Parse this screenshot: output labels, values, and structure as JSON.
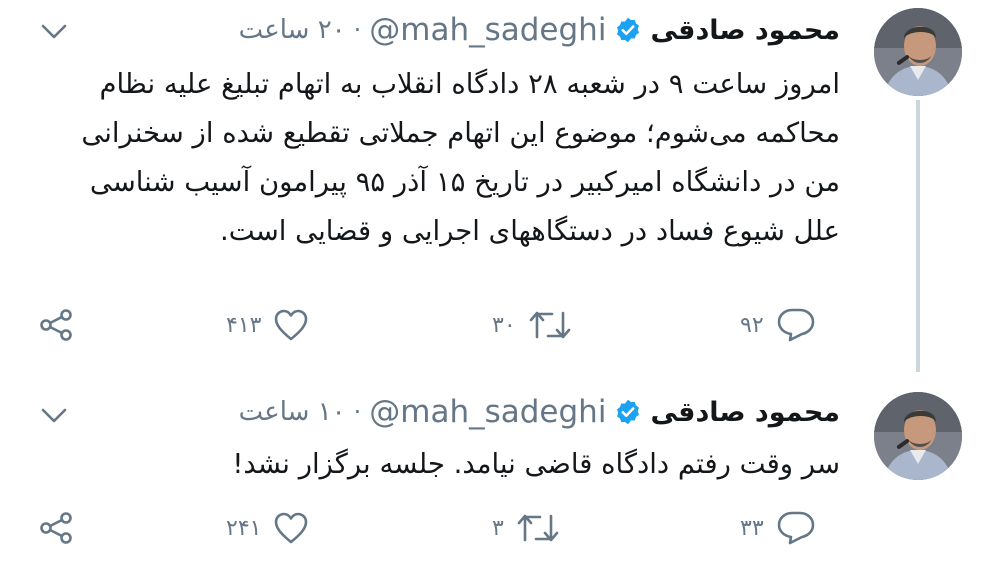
{
  "tweets": [
    {
      "author_name": "محمود صادقی",
      "handle": "@mah_sadeghi",
      "separator": "·",
      "time": "۲۰ ساعت",
      "text": "امروز ساعت ۹ در شعبه ۲۸ دادگاه انقلاب به اتهام تبلیغ علیه نظام محاکمه می‌شوم؛ موضوع این اتهام جملاتی تقطیع شده از سخنرانی من در دانشگاه امیرکبیر در تاریخ ۱۵ آذر ۹۵ پیرامون آسیب شناسی علل شیوع فساد در دستگاههای اجرایی و قضایی است.",
      "reply_count": "۹۲",
      "retweet_count": "۳۰",
      "like_count": "۴۱۳"
    },
    {
      "author_name": "محمود صادقی",
      "handle": "@mah_sadeghi",
      "separator": "·",
      "time": "۱۰ ساعت",
      "text": "سر وقت رفتم دادگاه قاضی نیامد. جلسه برگزار نشد!",
      "reply_count": "۳۳",
      "retweet_count": "۳",
      "like_count": "۲۴۱"
    }
  ],
  "colors": {
    "verified_badge": "#1da1f2",
    "muted_text": "#657786",
    "primary_text": "#14171a",
    "thread_line": "#ccd6dd"
  },
  "icons": [
    "verified-badge-icon",
    "chevron-down-icon",
    "reply-icon",
    "retweet-icon",
    "like-icon",
    "share-icon"
  ]
}
